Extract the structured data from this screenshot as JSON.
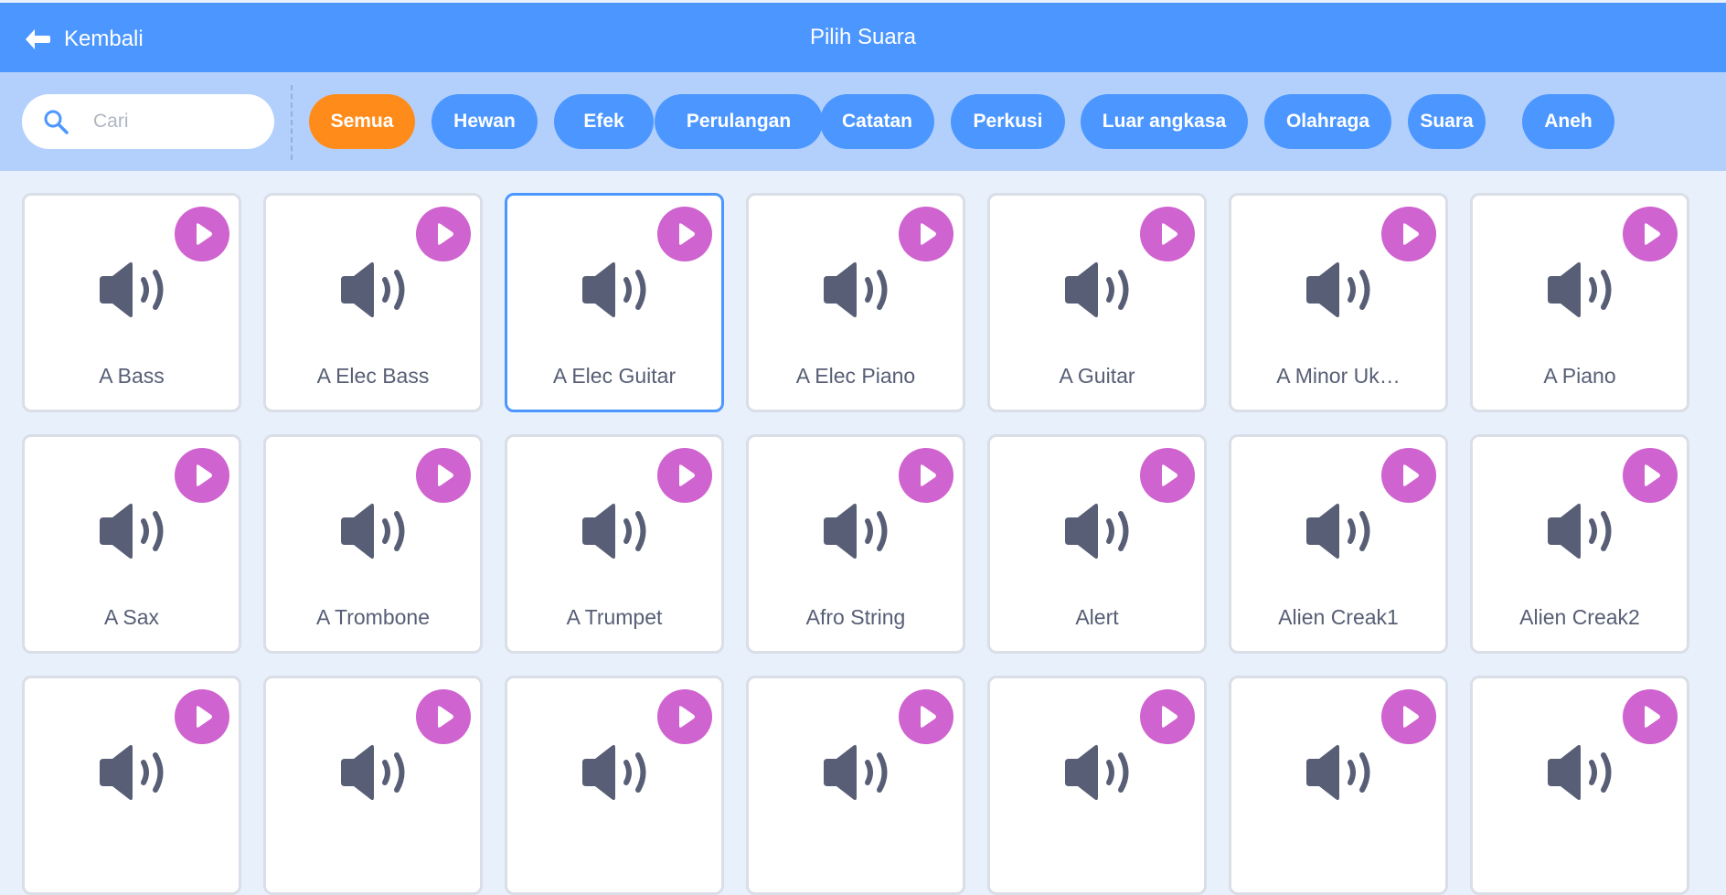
{
  "header": {
    "back_label": "Kembali",
    "title": "Pilih Suara"
  },
  "search": {
    "placeholder": "Cari",
    "value": ""
  },
  "categories": [
    {
      "label": "Semua",
      "active": true
    },
    {
      "label": "Hewan",
      "active": false
    },
    {
      "label": "Efek",
      "active": false
    },
    {
      "label": "Perulangan",
      "active": false
    },
    {
      "label": "Catatan",
      "active": false
    },
    {
      "label": "Perkusi",
      "active": false
    },
    {
      "label": "Luar angkasa",
      "active": false
    },
    {
      "label": "Olahraga",
      "active": false
    },
    {
      "label": "Suara",
      "active": false
    },
    {
      "label": "Aneh",
      "active": false
    }
  ],
  "sounds": [
    {
      "name": "A Bass",
      "selected": false
    },
    {
      "name": "A Elec Bass",
      "selected": false
    },
    {
      "name": "A Elec Guitar",
      "selected": true
    },
    {
      "name": "A Elec Piano",
      "selected": false
    },
    {
      "name": "A Guitar",
      "selected": false
    },
    {
      "name": "A Minor Uk…",
      "selected": false
    },
    {
      "name": "A Piano",
      "selected": false
    },
    {
      "name": "A Sax",
      "selected": false
    },
    {
      "name": "A Trombone",
      "selected": false
    },
    {
      "name": "A Trumpet",
      "selected": false
    },
    {
      "name": "Afro String",
      "selected": false
    },
    {
      "name": "Alert",
      "selected": false
    },
    {
      "name": "Alien Creak1",
      "selected": false
    },
    {
      "name": "Alien Creak2",
      "selected": false
    },
    {
      "name": "",
      "selected": false
    },
    {
      "name": "",
      "selected": false
    },
    {
      "name": "",
      "selected": false
    },
    {
      "name": "",
      "selected": false
    },
    {
      "name": "",
      "selected": false
    },
    {
      "name": "",
      "selected": false
    },
    {
      "name": "",
      "selected": false
    }
  ],
  "colors": {
    "header": "#4c97ff",
    "filter_bar": "#b3d0fd",
    "chip": "#4c97ff",
    "chip_active": "#ff8c1a",
    "play_button": "#cf63cf",
    "speaker_icon": "#575e75"
  },
  "icons": {
    "back": "arrow-left-icon",
    "search": "search-icon",
    "play": "play-icon",
    "sound": "speaker-icon"
  }
}
